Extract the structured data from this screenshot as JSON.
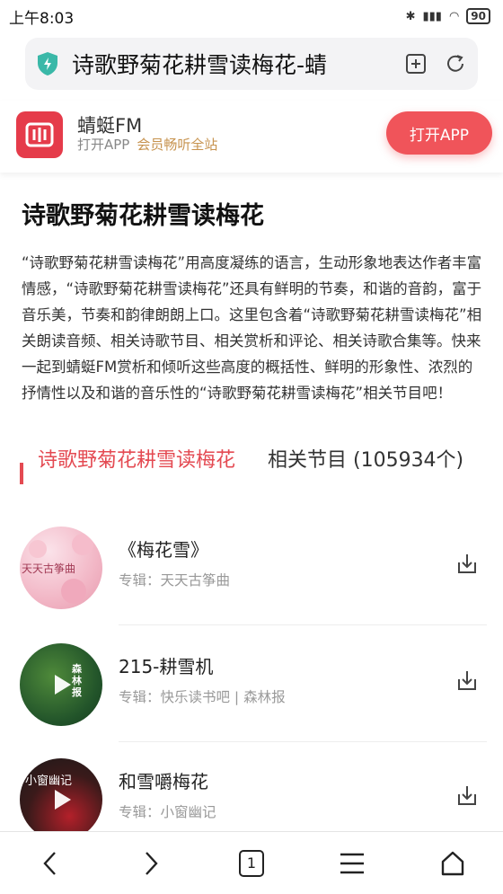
{
  "status_bar": {
    "time": "上午8:03",
    "battery": "90"
  },
  "browser": {
    "url_title": "诗歌野菊花耕雪读梅花-蜻",
    "tab_count": "1"
  },
  "app_banner": {
    "name": "蜻蜓FM",
    "sub1": "打开APP",
    "sub2": "会员畅听全站",
    "open_button": "打开APP"
  },
  "page": {
    "title": "诗歌野菊花耕雪读梅花",
    "description": "“诗歌野菊花耕雪读梅花”用高度凝练的语言，生动形象地表达作者丰富情感，“诗歌野菊花耕雪读梅花”还具有鲜明的节奏，和谐的音韵，富于音乐美，节奏和韵律朗朗上口。这里包含着“诗歌野菊花耕雪读梅花”相关朗读音频、相关诗歌节目、相关赏析和评论、相关诗歌合集等。快来一起到蜻蜓FM赏析和倾听这些高度的概括性、鲜明的形象性、浓烈的抒情性以及和谐的音乐性的“诗歌野菊花耕雪读梅花”相关节目吧！"
  },
  "section": {
    "name": "诗歌野菊花耕雪读梅花",
    "count_label": "相关节目 (105934个)"
  },
  "programs": [
    {
      "title": "《梅花雪》",
      "album": "专辑：天天古筝曲",
      "thumb_text": "天天古筝曲"
    },
    {
      "title": "215-耕雪机",
      "album": "专辑：快乐读书吧 | 森林报",
      "thumb_text": "森林报"
    },
    {
      "title": "和雪嚼梅花",
      "album": "专辑：小窗幽记",
      "thumb_text": "小窗幽记"
    }
  ],
  "colors": {
    "accent": "#e44a52",
    "open_button": "#f0545a",
    "vip_gold": "#c7934f"
  }
}
